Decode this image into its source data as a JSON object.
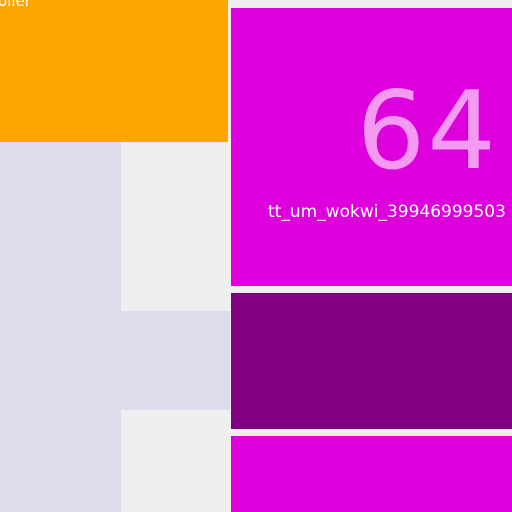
{
  "tiles": {
    "orange": {
      "label": "oller",
      "color": "#ffa500"
    },
    "magenta_main": {
      "count": "64",
      "name": "tt_um_wokwi_39946999503",
      "color": "#dd00dd"
    },
    "purple": {
      "color": "#800080"
    },
    "magenta_bottom": {
      "color": "#dd00dd"
    }
  },
  "colors": {
    "lavender": "#dcdcec",
    "background": "#efefef"
  }
}
